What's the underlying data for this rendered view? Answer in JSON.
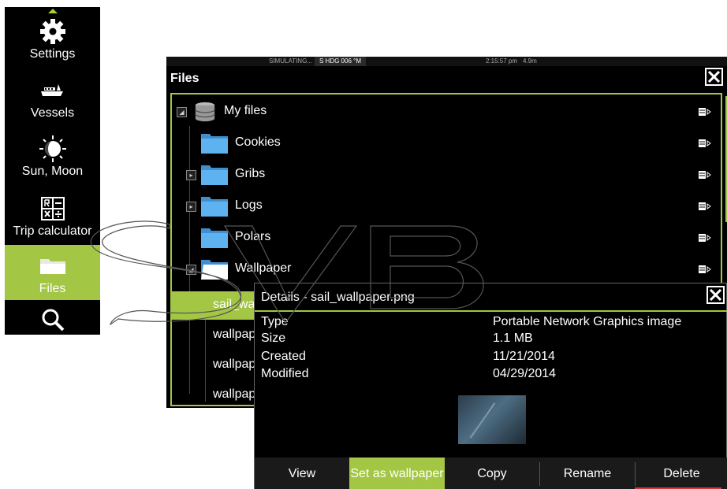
{
  "sidebar": {
    "items": [
      {
        "label": "Settings",
        "icon": "gear-icon"
      },
      {
        "label": "Vessels",
        "icon": "vessel-icon"
      },
      {
        "label": "Sun, Moon",
        "icon": "sun-moon-icon"
      },
      {
        "label": "Trip calculator",
        "icon": "calculator-icon"
      },
      {
        "label": "Files",
        "icon": "folder-icon",
        "active": true
      },
      {
        "label": "Find",
        "icon": "magnifier-icon"
      }
    ]
  },
  "status_bar": {
    "simulating": "SIMULATING...",
    "heading": "S HDG 006 °M",
    "time": "2:15:57 pm",
    "distance": "4.9m"
  },
  "files_window": {
    "title": "Files",
    "tree": [
      {
        "name": "My files",
        "expander": "expanded"
      },
      {
        "name": "Cookies"
      },
      {
        "name": "Gribs",
        "expander": "collapsed"
      },
      {
        "name": "Logs",
        "expander": "collapsed"
      },
      {
        "name": "Polars"
      },
      {
        "name": "Wallpaper",
        "expander": "expanded"
      },
      {
        "name": "sail_wal"
      },
      {
        "name": "wallpap"
      },
      {
        "name": "wallpap"
      },
      {
        "name": "wallpap"
      }
    ]
  },
  "details": {
    "title": "Details - sail_wallpaper.png",
    "fields": [
      {
        "key": "Type",
        "value": "Portable Network Graphics image"
      },
      {
        "key": "Size",
        "value": "1.1 MB"
      },
      {
        "key": "Created",
        "value": "11/21/2014"
      },
      {
        "key": "Modified",
        "value": "04/29/2014"
      }
    ],
    "buttons": [
      {
        "label": "View"
      },
      {
        "label": "Set as wallpaper",
        "active": true
      },
      {
        "label": "Copy"
      },
      {
        "label": "Rename"
      },
      {
        "label": "Delete"
      }
    ]
  },
  "colors": {
    "accent": "#a3c644",
    "background": "#000000",
    "danger": "#d23a3a"
  }
}
